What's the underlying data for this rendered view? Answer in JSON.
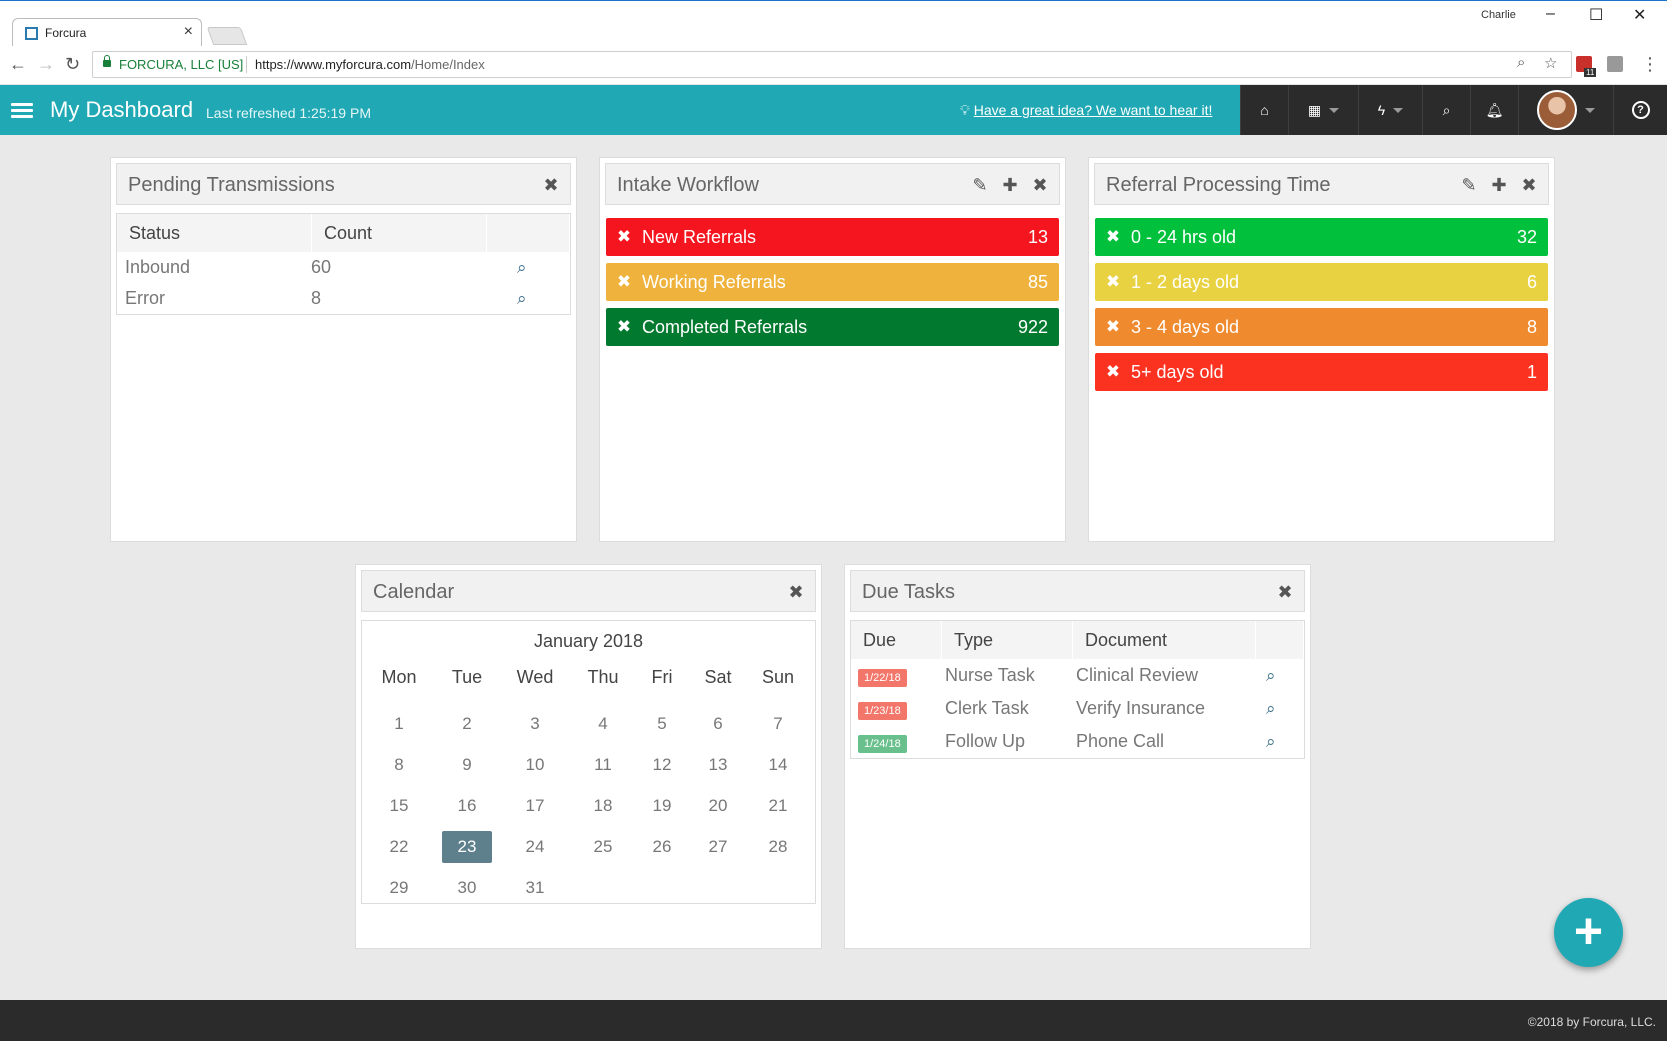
{
  "browser": {
    "tab_title": "Forcura",
    "user": "Charlie",
    "site_identity": "FORCURA, LLC [US]",
    "url_host": "https://www.myforcura.com",
    "url_path": "/Home/Index",
    "extension_badge": "11"
  },
  "header": {
    "title": "My Dashboard",
    "last_refreshed": "Last refreshed 1:25:19 PM",
    "idea_link": "Have a great idea? We want to hear it!"
  },
  "pending": {
    "title": "Pending Transmissions",
    "columns": [
      "Status",
      "Count"
    ],
    "rows": [
      {
        "status": "Inbound",
        "count": "60"
      },
      {
        "status": "Error",
        "count": "8"
      }
    ]
  },
  "intake": {
    "title": "Intake Workflow",
    "items": [
      {
        "label": "New Referrals",
        "count": "13",
        "color": "#f4151f"
      },
      {
        "label": "Working Referrals",
        "count": "85",
        "color": "#efb33d"
      },
      {
        "label": "Completed Referrals",
        "count": "922",
        "color": "#017a2f"
      }
    ]
  },
  "referral_time": {
    "title": "Referral Processing Time",
    "items": [
      {
        "label": "0 - 24 hrs old",
        "count": "32",
        "color": "#00c03c"
      },
      {
        "label": "1 - 2 days old",
        "count": "6",
        "color": "#e8d242"
      },
      {
        "label": "3 - 4 days old",
        "count": "8",
        "color": "#ef8a2e"
      },
      {
        "label": "5+ days old",
        "count": "1",
        "color": "#fc3220"
      }
    ]
  },
  "calendar": {
    "title": "Calendar",
    "month": "January 2018",
    "weekdays": [
      "Mon",
      "Tue",
      "Wed",
      "Thu",
      "Fri",
      "Sat",
      "Sun"
    ],
    "weeks": [
      [
        "1",
        "2",
        "3",
        "4",
        "5",
        "6",
        "7"
      ],
      [
        "8",
        "9",
        "10",
        "11",
        "12",
        "13",
        "14"
      ],
      [
        "15",
        "16",
        "17",
        "18",
        "19",
        "20",
        "21"
      ],
      [
        "22",
        "23",
        "24",
        "25",
        "26",
        "27",
        "28"
      ],
      [
        "29",
        "30",
        "31",
        "",
        "",
        "",
        ""
      ]
    ],
    "today": "23"
  },
  "due_tasks": {
    "title": "Due Tasks",
    "columns": [
      "Due",
      "Type",
      "Document"
    ],
    "rows": [
      {
        "due": "1/22/18",
        "type": "Nurse Task",
        "document": "Clinical Review",
        "badge_color": "#f2766a"
      },
      {
        "due": "1/23/18",
        "type": "Clerk Task",
        "document": "Verify Insurance",
        "badge_color": "#f2766a"
      },
      {
        "due": "1/24/18",
        "type": "Follow Up",
        "document": "Phone Call",
        "badge_color": "#69c08c"
      }
    ]
  },
  "footer": {
    "copyright": "©2018 by Forcura, LLC."
  },
  "colors": {
    "header_bg": "#20a9b4",
    "toolbar_bg": "#2b2b2b",
    "today_bg": "#5e7f8c"
  },
  "icons": {
    "remove": "remove-icon",
    "edit": "edit-icon",
    "add": "add-icon",
    "search": "search-icon"
  }
}
